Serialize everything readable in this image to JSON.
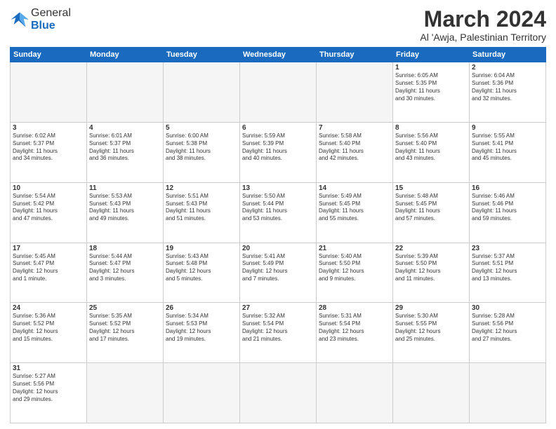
{
  "header": {
    "logo_general": "General",
    "logo_blue": "Blue",
    "month_year": "March 2024",
    "location": "Al 'Awja, Palestinian Territory"
  },
  "weekdays": [
    "Sunday",
    "Monday",
    "Tuesday",
    "Wednesday",
    "Thursday",
    "Friday",
    "Saturday"
  ],
  "weeks": [
    [
      {
        "day": "",
        "info": ""
      },
      {
        "day": "",
        "info": ""
      },
      {
        "day": "",
        "info": ""
      },
      {
        "day": "",
        "info": ""
      },
      {
        "day": "",
        "info": ""
      },
      {
        "day": "1",
        "info": "Sunrise: 6:05 AM\nSunset: 5:35 PM\nDaylight: 11 hours\nand 30 minutes."
      },
      {
        "day": "2",
        "info": "Sunrise: 6:04 AM\nSunset: 5:36 PM\nDaylight: 11 hours\nand 32 minutes."
      }
    ],
    [
      {
        "day": "3",
        "info": "Sunrise: 6:02 AM\nSunset: 5:37 PM\nDaylight: 11 hours\nand 34 minutes."
      },
      {
        "day": "4",
        "info": "Sunrise: 6:01 AM\nSunset: 5:37 PM\nDaylight: 11 hours\nand 36 minutes."
      },
      {
        "day": "5",
        "info": "Sunrise: 6:00 AM\nSunset: 5:38 PM\nDaylight: 11 hours\nand 38 minutes."
      },
      {
        "day": "6",
        "info": "Sunrise: 5:59 AM\nSunset: 5:39 PM\nDaylight: 11 hours\nand 40 minutes."
      },
      {
        "day": "7",
        "info": "Sunrise: 5:58 AM\nSunset: 5:40 PM\nDaylight: 11 hours\nand 42 minutes."
      },
      {
        "day": "8",
        "info": "Sunrise: 5:56 AM\nSunset: 5:40 PM\nDaylight: 11 hours\nand 43 minutes."
      },
      {
        "day": "9",
        "info": "Sunrise: 5:55 AM\nSunset: 5:41 PM\nDaylight: 11 hours\nand 45 minutes."
      }
    ],
    [
      {
        "day": "10",
        "info": "Sunrise: 5:54 AM\nSunset: 5:42 PM\nDaylight: 11 hours\nand 47 minutes."
      },
      {
        "day": "11",
        "info": "Sunrise: 5:53 AM\nSunset: 5:43 PM\nDaylight: 11 hours\nand 49 minutes."
      },
      {
        "day": "12",
        "info": "Sunrise: 5:51 AM\nSunset: 5:43 PM\nDaylight: 11 hours\nand 51 minutes."
      },
      {
        "day": "13",
        "info": "Sunrise: 5:50 AM\nSunset: 5:44 PM\nDaylight: 11 hours\nand 53 minutes."
      },
      {
        "day": "14",
        "info": "Sunrise: 5:49 AM\nSunset: 5:45 PM\nDaylight: 11 hours\nand 55 minutes."
      },
      {
        "day": "15",
        "info": "Sunrise: 5:48 AM\nSunset: 5:45 PM\nDaylight: 11 hours\nand 57 minutes."
      },
      {
        "day": "16",
        "info": "Sunrise: 5:46 AM\nSunset: 5:46 PM\nDaylight: 11 hours\nand 59 minutes."
      }
    ],
    [
      {
        "day": "17",
        "info": "Sunrise: 5:45 AM\nSunset: 5:47 PM\nDaylight: 12 hours\nand 1 minute."
      },
      {
        "day": "18",
        "info": "Sunrise: 5:44 AM\nSunset: 5:47 PM\nDaylight: 12 hours\nand 3 minutes."
      },
      {
        "day": "19",
        "info": "Sunrise: 5:43 AM\nSunset: 5:48 PM\nDaylight: 12 hours\nand 5 minutes."
      },
      {
        "day": "20",
        "info": "Sunrise: 5:41 AM\nSunset: 5:49 PM\nDaylight: 12 hours\nand 7 minutes."
      },
      {
        "day": "21",
        "info": "Sunrise: 5:40 AM\nSunset: 5:50 PM\nDaylight: 12 hours\nand 9 minutes."
      },
      {
        "day": "22",
        "info": "Sunrise: 5:39 AM\nSunset: 5:50 PM\nDaylight: 12 hours\nand 11 minutes."
      },
      {
        "day": "23",
        "info": "Sunrise: 5:37 AM\nSunset: 5:51 PM\nDaylight: 12 hours\nand 13 minutes."
      }
    ],
    [
      {
        "day": "24",
        "info": "Sunrise: 5:36 AM\nSunset: 5:52 PM\nDaylight: 12 hours\nand 15 minutes."
      },
      {
        "day": "25",
        "info": "Sunrise: 5:35 AM\nSunset: 5:52 PM\nDaylight: 12 hours\nand 17 minutes."
      },
      {
        "day": "26",
        "info": "Sunrise: 5:34 AM\nSunset: 5:53 PM\nDaylight: 12 hours\nand 19 minutes."
      },
      {
        "day": "27",
        "info": "Sunrise: 5:32 AM\nSunset: 5:54 PM\nDaylight: 12 hours\nand 21 minutes."
      },
      {
        "day": "28",
        "info": "Sunrise: 5:31 AM\nSunset: 5:54 PM\nDaylight: 12 hours\nand 23 minutes."
      },
      {
        "day": "29",
        "info": "Sunrise: 5:30 AM\nSunset: 5:55 PM\nDaylight: 12 hours\nand 25 minutes."
      },
      {
        "day": "30",
        "info": "Sunrise: 5:28 AM\nSunset: 5:56 PM\nDaylight: 12 hours\nand 27 minutes."
      }
    ],
    [
      {
        "day": "31",
        "info": "Sunrise: 5:27 AM\nSunset: 5:56 PM\nDaylight: 12 hours\nand 29 minutes."
      },
      {
        "day": "",
        "info": ""
      },
      {
        "day": "",
        "info": ""
      },
      {
        "day": "",
        "info": ""
      },
      {
        "day": "",
        "info": ""
      },
      {
        "day": "",
        "info": ""
      },
      {
        "day": "",
        "info": ""
      }
    ]
  ]
}
